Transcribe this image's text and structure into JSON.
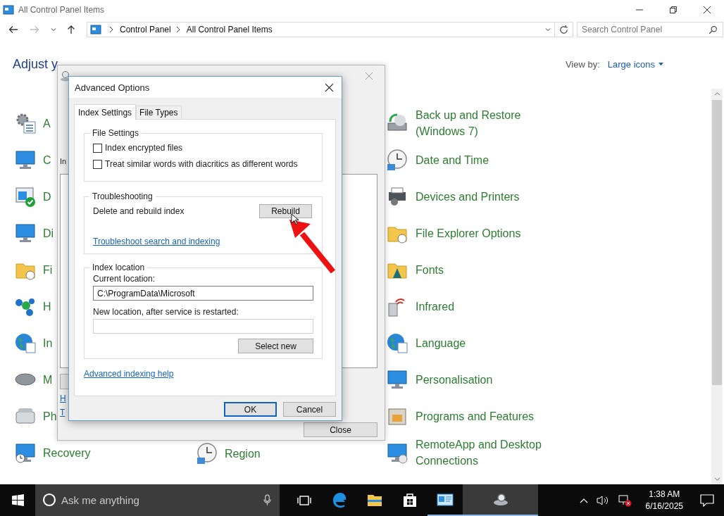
{
  "window": {
    "title": "All Control Panel Items"
  },
  "navigation": {
    "back_disabled": false,
    "forward_disabled": true,
    "breadcrumb": [
      "Control Panel",
      "All Control Panel Items"
    ],
    "search": {
      "placeholder": "Search Control Panel"
    }
  },
  "header": {
    "title": "Adjust y",
    "view_by_label": "View by:",
    "view_by_value": "Large icons"
  },
  "columns": [
    {
      "items": [
        {
          "label": "A"
        },
        {
          "label": "C"
        },
        {
          "label": "D"
        },
        {
          "label": "Di"
        },
        {
          "label": "Fi"
        },
        {
          "label": "H"
        },
        {
          "label": "In"
        },
        {
          "label": "M"
        },
        {
          "label": "Ph"
        },
        {
          "label": "Recovery"
        }
      ]
    },
    {
      "items": [
        {
          "label": "Region"
        }
      ]
    },
    {
      "items": [
        {
          "label": "Back up and Restore (Windows 7)"
        },
        {
          "label": "Date and Time"
        },
        {
          "label": "Devices and Printers"
        },
        {
          "label": "File Explorer Options"
        },
        {
          "label": "Fonts"
        },
        {
          "label": "Infrared"
        },
        {
          "label": "Language"
        },
        {
          "label": "Personalisation"
        },
        {
          "label": "Programs and Features"
        },
        {
          "label": "RemoteApp and Desktop Connections"
        }
      ]
    }
  ],
  "indexing_options": {
    "label_fragment": "In",
    "link_fragments": [
      "H",
      "T"
    ],
    "close_button": "Close"
  },
  "advanced_options": {
    "title": "Advanced Options",
    "tabs": [
      {
        "label": "Index Settings",
        "selected": true
      },
      {
        "label": "File Types",
        "selected": false
      }
    ],
    "file_settings": {
      "title": "File Settings",
      "options": [
        {
          "label": "Index encrypted files",
          "checked": false
        },
        {
          "label": "Treat similar words with diacritics as different words",
          "checked": false
        }
      ]
    },
    "troubleshooting": {
      "title": "Troubleshooting",
      "description": "Delete and rebuild index",
      "button": "Rebuild",
      "link": "Troubleshoot search and indexing"
    },
    "index_location": {
      "title": "Index location",
      "current_label": "Current location:",
      "current_value": "C:\\ProgramData\\Microsoft",
      "new_label": "New location, after service is restarted:",
      "button": "Select new"
    },
    "help_link": "Advanced indexing help",
    "buttons": [
      {
        "label": "OK",
        "default": true
      },
      {
        "label": "Cancel",
        "default": false
      }
    ]
  },
  "taskbar": {
    "search_placeholder": "Ask me anything",
    "apps": [
      {
        "running": false,
        "selected": false
      },
      {
        "running": false,
        "selected": false
      },
      {
        "running": false,
        "selected": false
      },
      {
        "running": true,
        "selected": false
      },
      {
        "running": true,
        "selected": true
      }
    ],
    "time": "1:38 AM",
    "date": "6/16/2025"
  }
}
